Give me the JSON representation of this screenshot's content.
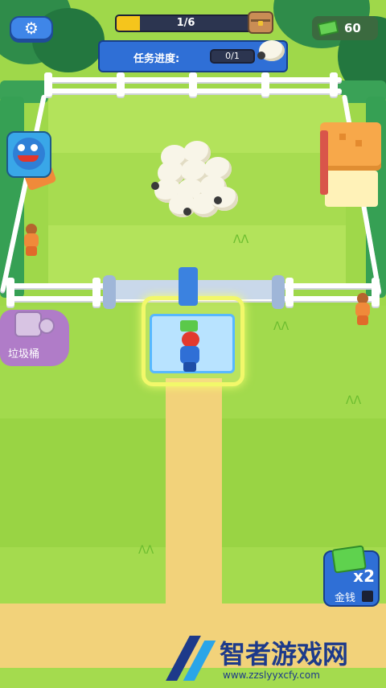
{
  "hud": {
    "level_progress_text": "1/6",
    "level_progress_fraction": 0.1667,
    "money_amount": "60",
    "task_label": "任务进度:",
    "task_progress_text": "0/1"
  },
  "buttons": {
    "trash_label": "垃圾桶",
    "money_boost_multiplier": "x2",
    "money_boost_label": "金钱"
  },
  "watermark": {
    "title": "智者游戏网",
    "url": "www.zzslyyxcfy.com"
  },
  "icons": {
    "settings": "gear-icon",
    "chest": "treasure-chest-icon",
    "cash": "cash-icon",
    "sheep_task": "sheep-icon",
    "character": "huggy-avatar-icon",
    "trash": "trash-can-icon",
    "boost": "cash-stack-icon",
    "video": "video-ad-icon"
  },
  "colors": {
    "hud_blue": "#2f6fd6",
    "progress_yellow": "#f5c51c",
    "grass": "#9fd84a",
    "path": "#f2d27a",
    "trash_purple": "#b07cc8"
  }
}
